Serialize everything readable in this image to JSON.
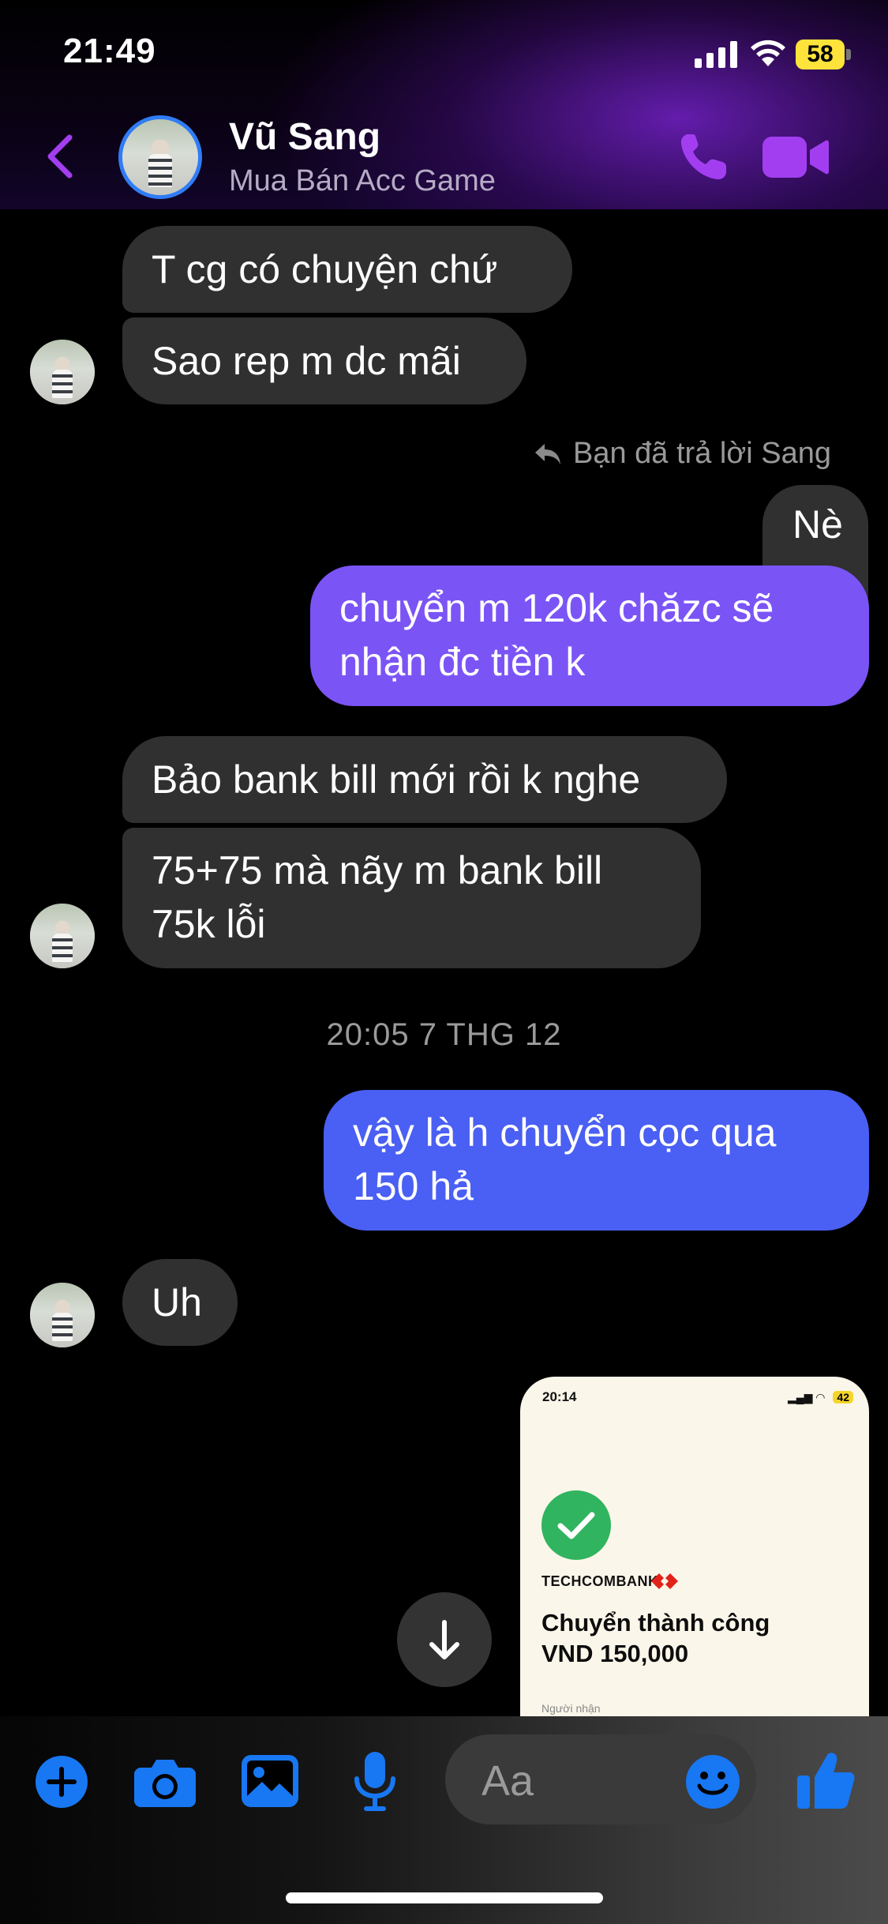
{
  "status_bar": {
    "time": "21:49",
    "battery": "58"
  },
  "header": {
    "contact_name": "Vũ Sang",
    "subtitle": "Mua Bán Acc Game"
  },
  "messages": {
    "m1": "T cg có chuyện chứ",
    "m2": "Sao rep m dc mãi",
    "reply_note": "Bạn đã trả lời Sang",
    "quoted": "Nè",
    "m3_line1": "chuyển m 120k chăzc sẽ",
    "m3_line2": "nhận đc tiền k",
    "m4": "Bảo bank bill mới rồi k nghe",
    "m5_line1": "75+75 mà nãy m bank bill",
    "m5_line2": "75k lỗi",
    "timestamp": "20:05 7 THG 12",
    "m6_line1": "vậy là h chuyển cọc qua",
    "m6_line2": "150 hả",
    "m7": "Uh"
  },
  "shared_image": {
    "time": "20:14",
    "battery": "42",
    "bank": "TECHCOMBANK",
    "title": "Chuyển thành công",
    "amount": "VND 150,000",
    "recipient_label": "Người nhận"
  },
  "composer": {
    "placeholder": "Aa"
  },
  "colors": {
    "accent_purple": "#9b3cf0",
    "accent_blue": "#1877f2",
    "outgoing_purple": "#7b54f6",
    "outgoing_blue": "#4a5ff3",
    "incoming": "#303030"
  }
}
